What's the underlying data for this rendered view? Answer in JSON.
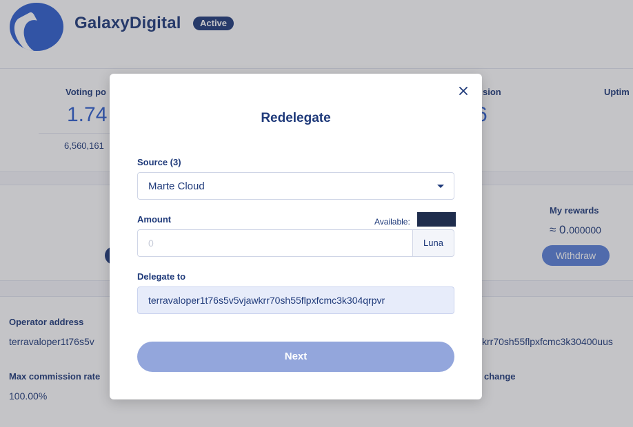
{
  "validator": {
    "name": "GalaxyDigital",
    "status": "Active"
  },
  "stats": {
    "voting_power_label": "Voting po",
    "voting_power_value": "1.74",
    "voting_power_sub": "6,560,161",
    "commission_label": "sion",
    "commission_value": "6",
    "uptime_label": "Uptim"
  },
  "rewards": {
    "label": "My rewards",
    "approx": "≈ 0.",
    "decimals": "000000",
    "withdraw_label": "Withdraw"
  },
  "info": {
    "operator_label": "Operator address",
    "operator_value": "terravaloper1t76s5v",
    "account_value": "krr70sh55flpxfcmc3k30400uus",
    "max_commission_label": "Max commission rate",
    "max_commission_value": "100.00%",
    "change_label": "change"
  },
  "modal": {
    "title": "Redelegate",
    "source_label": "Source (3)",
    "source_value": "Marte Cloud",
    "amount_label": "Amount",
    "available_label": "Available:",
    "amount_placeholder": "0",
    "amount_unit": "Luna",
    "delegate_to_label": "Delegate to",
    "delegate_to_value": "terravaloper1t76s5v5vjawkrr70sh55flpxfcmc3k304qrpvr",
    "next_label": "Next"
  }
}
